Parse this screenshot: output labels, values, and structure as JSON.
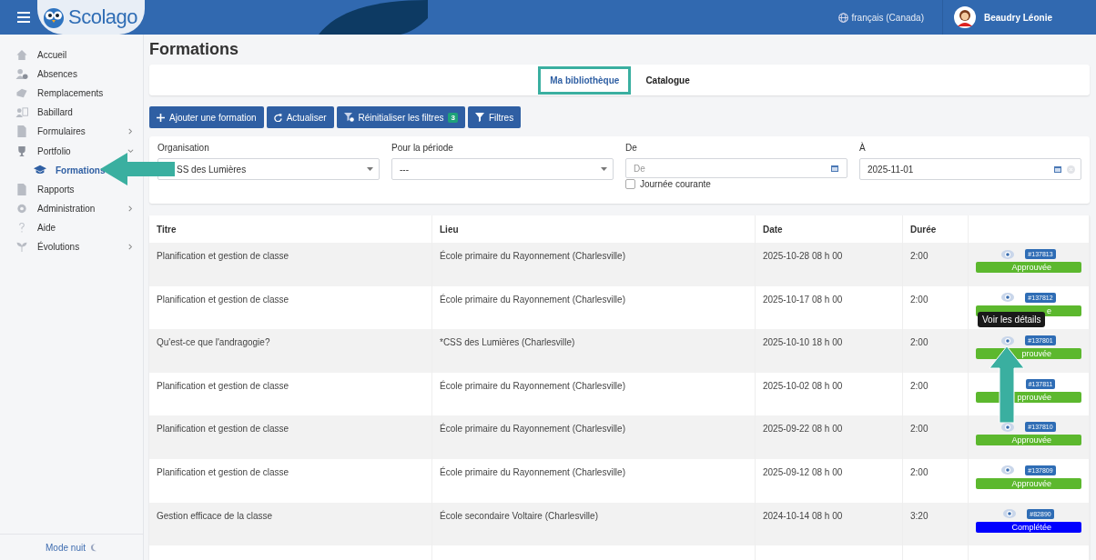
{
  "header": {
    "brand": "Scolago",
    "language": "français (Canada)",
    "user": "Beaudry Léonie"
  },
  "sidebar": {
    "items": [
      {
        "label": "Accueil"
      },
      {
        "label": "Absences"
      },
      {
        "label": "Remplacements"
      },
      {
        "label": "Babillard"
      },
      {
        "label": "Formulaires",
        "expanded": false
      },
      {
        "label": "Portfolio",
        "expanded": true,
        "children": [
          {
            "label": "Formations",
            "selected": true
          }
        ]
      },
      {
        "label": "Rapports"
      },
      {
        "label": "Administration",
        "expanded": false
      },
      {
        "label": "Aide"
      },
      {
        "label": "Évolutions",
        "expanded": false
      }
    ],
    "footer": "Mode nuit"
  },
  "page": {
    "title": "Formations"
  },
  "tabs": [
    {
      "label": "Ma bibliothèque",
      "selected": true
    },
    {
      "label": "Catalogue",
      "selected": false
    }
  ],
  "toolbar": [
    {
      "kind": "add",
      "label": "Ajouter une formation"
    },
    {
      "kind": "refresh",
      "label": "Actualiser"
    },
    {
      "kind": "reset",
      "label": "Réinitialiser les filtres",
      "badge": "3"
    },
    {
      "kind": "filter",
      "label": "Filtres"
    }
  ],
  "filters": {
    "organisation": {
      "label": "Organisation",
      "value": "SS des Lumières"
    },
    "period": {
      "label": "Pour la période",
      "value": "---"
    },
    "from": {
      "label": "De",
      "placeholder": "De",
      "current_day": {
        "label": "Journée courante",
        "checked": false
      }
    },
    "to": {
      "label": "À",
      "value": "2025-11-01"
    }
  },
  "table": {
    "columns": [
      "Titre",
      "Lieu",
      "Date",
      "Durée"
    ],
    "rows": [
      {
        "title": "Planification et gestion de classe",
        "place": "École primaire du Rayonnement (Charlesville)",
        "date": "2025-10-28 08 h 00",
        "duration": "2:00",
        "eye": true,
        "id": "#137813",
        "status": "Approuvée",
        "color": "#5cb82e"
      },
      {
        "title": "Planification et gestion de classe",
        "place": "École primaire du Rayonnement (Charlesville)",
        "date": "2025-10-17 08 h 00",
        "duration": "2:00",
        "eye": true,
        "id": "#137812",
        "status": "e",
        "color": "#5cb82e"
      },
      {
        "title": "Qu'est-ce que l'andragogie?",
        "place": "*CSS des Lumières (Charlesville)",
        "date": "2025-10-10 18 h 00",
        "duration": "2:00",
        "eye": true,
        "id": "#137801",
        "status": "prouvée",
        "color": "#5cb82e",
        "tooltip": "Voir les détails"
      },
      {
        "title": "Planification et gestion de classe",
        "place": "École primaire du Rayonnement (Charlesville)",
        "date": "2025-10-02 08 h 00",
        "duration": "2:00",
        "eye": false,
        "id": "#137811",
        "status": "pprouvée",
        "color": "#5cb82e"
      },
      {
        "title": "Planification et gestion de classe",
        "place": "École primaire du Rayonnement (Charlesville)",
        "date": "2025-09-22 08 h 00",
        "duration": "2:00",
        "eye": true,
        "id": "#137810",
        "status": "Approuvée",
        "color": "#5cb82e"
      },
      {
        "title": "Planification et gestion de classe",
        "place": "École primaire du Rayonnement (Charlesville)",
        "date": "2025-09-12 08 h 00",
        "duration": "2:00",
        "eye": true,
        "id": "#137809",
        "status": "Approuvée",
        "color": "#5cb82e"
      },
      {
        "title": "Gestion efficace de la classe",
        "place": "École secondaire Voltaire (Charlesville)",
        "date": "2024-10-14 08 h 00",
        "duration": "3:20",
        "eye": true,
        "id": "#82890",
        "status": "Complétée",
        "color": "#0000ff"
      }
    ]
  }
}
